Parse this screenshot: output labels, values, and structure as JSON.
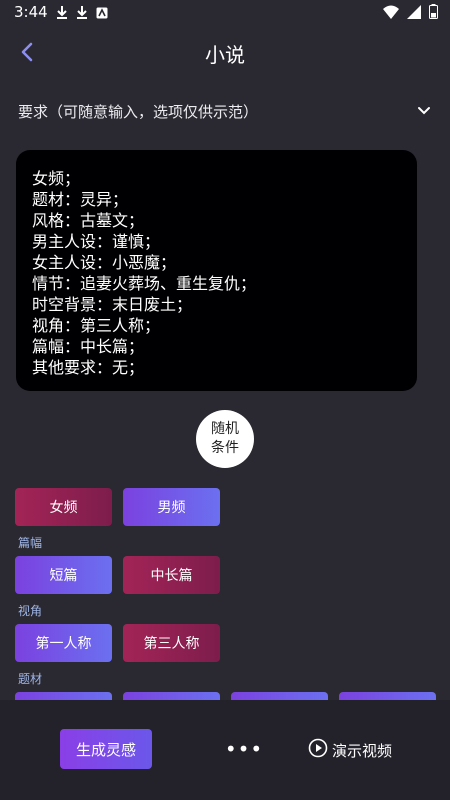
{
  "status_bar": {
    "time": "3:44"
  },
  "header": {
    "title": "小说"
  },
  "requirement": {
    "label": "要求（可随意输入，选项仅供示范）"
  },
  "prompt": {
    "lines": [
      "女频；",
      "题材：灵异；",
      "风格：古墓文；",
      "男主人设：谨慎；",
      "女主人设：小恶魔；",
      "情节：追妻火葬场、重生复仇；",
      "时空背景：末日废土；",
      "视角：第三人称；",
      "篇幅：中长篇；",
      "其他要求：无；"
    ]
  },
  "random": {
    "line1": "随机",
    "line2": "条件"
  },
  "gender": {
    "options": [
      "女频",
      "男频"
    ],
    "selected": "女频"
  },
  "length": {
    "label": "篇幅",
    "options": [
      "短篇",
      "中长篇"
    ],
    "selected": "中长篇"
  },
  "perspective": {
    "label": "视角",
    "options": [
      "第一人称",
      "第三人称"
    ],
    "selected": "第三人称"
  },
  "theme": {
    "label": "题材"
  },
  "bottom": {
    "generate": "生成灵感",
    "more": "•••",
    "demo": "演示视频"
  },
  "colors": {
    "background": "#2a2830",
    "selected_chip": "#a32456",
    "unselected_chip": "#7b41e0",
    "section_label": "#9fb6e6"
  }
}
